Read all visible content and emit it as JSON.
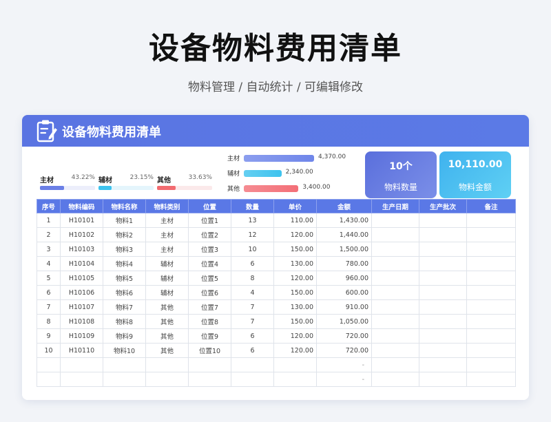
{
  "page": {
    "title": "设备物料费用清单",
    "subtitle": "物料管理 / 自动统计 / 可编辑修改"
  },
  "card": {
    "title": "设备物料费用清单",
    "icon": "clipboard-edit-icon",
    "header_color": "#5a74e2"
  },
  "shares": [
    {
      "label": "主材",
      "pct": "43.22%",
      "value": 0.4322,
      "color": "#6a7fe6",
      "track": "#eceefb"
    },
    {
      "label": "辅材",
      "pct": "23.15%",
      "value": 0.2315,
      "color": "#3ec3ee",
      "track": "#e4f5fc"
    },
    {
      "label": "其他",
      "pct": "33.63%",
      "value": 0.3363,
      "color": "#f26b70",
      "track": "#fbe9ea"
    }
  ],
  "chart_data": {
    "type": "bar",
    "orientation": "horizontal",
    "categories": [
      "主材",
      "辅材",
      "其他"
    ],
    "values": [
      4370,
      2340,
      3400
    ],
    "value_labels": [
      "4,370.00",
      "2,340.00",
      "3,400.00"
    ],
    "xlim": [
      0,
      4370
    ],
    "colors": [
      "#6f86ea",
      "#3ec3ee",
      "#f36f77"
    ]
  },
  "kpis": [
    {
      "value": "10个",
      "label": "物料数量",
      "color": "#5d74de"
    },
    {
      "value": "10,110.00",
      "label": "物料金额",
      "color": "#47b9f0"
    }
  ],
  "table": {
    "headers": [
      "序号",
      "物料编码",
      "物料名称",
      "物料类别",
      "位置",
      "数量",
      "单价",
      "金额",
      "生产日期",
      "生产批次",
      "备注"
    ],
    "rows": [
      [
        "1",
        "H10101",
        "物料1",
        "主材",
        "位置1",
        "13",
        "110.00",
        "1,430.00",
        "",
        "",
        ""
      ],
      [
        "2",
        "H10102",
        "物料2",
        "主材",
        "位置2",
        "12",
        "120.00",
        "1,440.00",
        "",
        "",
        ""
      ],
      [
        "3",
        "H10103",
        "物料3",
        "主材",
        "位置3",
        "10",
        "150.00",
        "1,500.00",
        "",
        "",
        ""
      ],
      [
        "4",
        "H10104",
        "物料4",
        "辅材",
        "位置4",
        "6",
        "130.00",
        "780.00",
        "",
        "",
        ""
      ],
      [
        "5",
        "H10105",
        "物料5",
        "辅材",
        "位置5",
        "8",
        "120.00",
        "960.00",
        "",
        "",
        ""
      ],
      [
        "6",
        "H10106",
        "物料6",
        "辅材",
        "位置6",
        "4",
        "150.00",
        "600.00",
        "",
        "",
        ""
      ],
      [
        "7",
        "H10107",
        "物料7",
        "其他",
        "位置7",
        "7",
        "130.00",
        "910.00",
        "",
        "",
        ""
      ],
      [
        "8",
        "H10108",
        "物料8",
        "其他",
        "位置8",
        "7",
        "150.00",
        "1,050.00",
        "",
        "",
        ""
      ],
      [
        "9",
        "H10109",
        "物料9",
        "其他",
        "位置9",
        "6",
        "120.00",
        "720.00",
        "",
        "",
        ""
      ],
      [
        "10",
        "H10110",
        "物料10",
        "其他",
        "位置10",
        "6",
        "120.00",
        "720.00",
        "",
        "",
        ""
      ],
      [
        "",
        "",
        "",
        "",
        "",
        "",
        "",
        "-",
        "",
        "",
        ""
      ],
      [
        "",
        "",
        "",
        "",
        "",
        "",
        "",
        "-",
        "",
        "",
        ""
      ]
    ]
  }
}
